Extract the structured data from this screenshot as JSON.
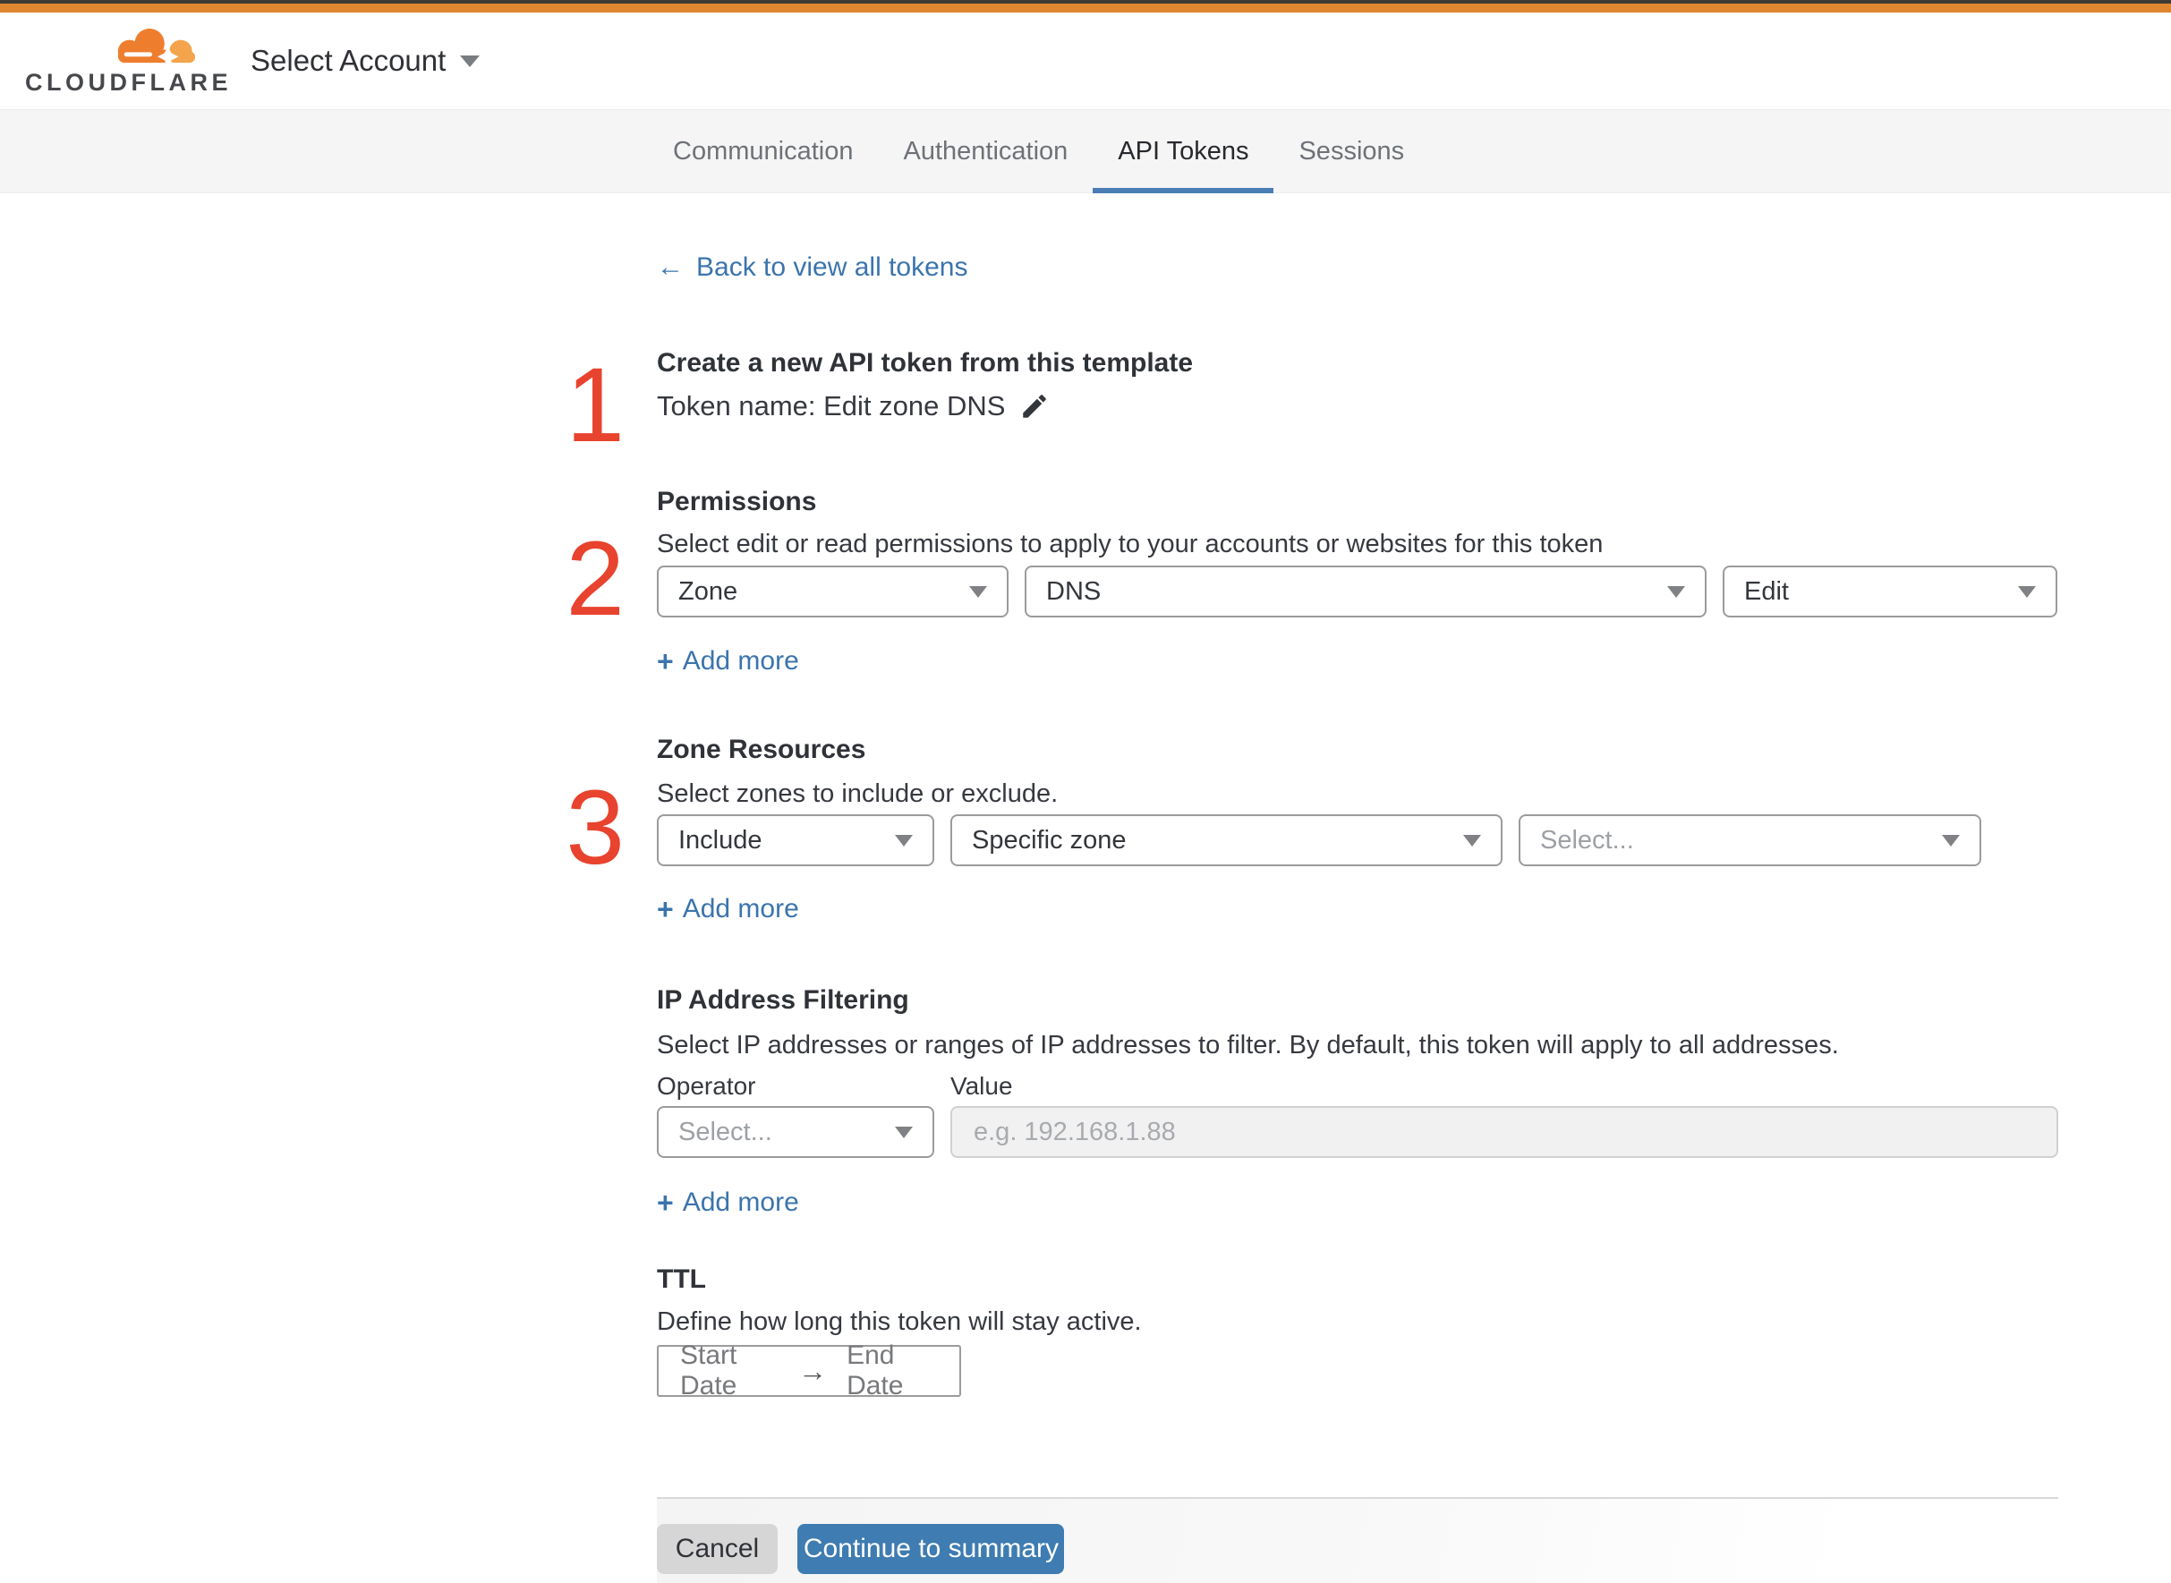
{
  "header": {
    "brand": "CLOUDFLARE",
    "account_selector_label": "Select Account"
  },
  "tabs": [
    {
      "label": "Communication"
    },
    {
      "label": "Authentication"
    },
    {
      "label": "API Tokens"
    },
    {
      "label": "Sessions"
    }
  ],
  "active_tab": "API Tokens",
  "icons": {
    "back_arrow": "←",
    "plus": "+",
    "range_arrow": "→"
  },
  "back_link_label": "Back to view all tokens",
  "steps": [
    "1",
    "2",
    "3"
  ],
  "template_section": {
    "heading": "Create a new API token from this template",
    "token_name_label": "Token name: Edit zone DNS"
  },
  "permissions": {
    "heading": "Permissions",
    "description": "Select edit or read permissions to apply to your accounts or websites for this token",
    "scope_value": "Zone",
    "resource_value": "DNS",
    "access_value": "Edit",
    "add_more_label": "Add more"
  },
  "zone_resources": {
    "heading": "Zone Resources",
    "description": "Select zones to include or exclude.",
    "mode_value": "Include",
    "type_value": "Specific zone",
    "zone_placeholder": "Select...",
    "add_more_label": "Add more"
  },
  "ip_filtering": {
    "heading": "IP Address Filtering",
    "description": "Select IP addresses or ranges of IP addresses to filter. By default, this token will apply to all addresses.",
    "operator_label": "Operator",
    "value_label": "Value",
    "operator_placeholder": "Select...",
    "value_placeholder": "e.g. 192.168.1.88",
    "add_more_label": "Add more"
  },
  "ttl": {
    "heading": "TTL",
    "description": "Define how long this token will stay active.",
    "start_label": "Start Date",
    "end_label": "End Date"
  },
  "footer": {
    "cancel_label": "Cancel",
    "continue_label": "Continue to summary"
  },
  "colors": {
    "top_bar_orange": "#df862f",
    "link_blue": "#3b74ac",
    "active_tab_underline": "#4a7eb5",
    "primary_button_blue": "#3e7cb1",
    "step_number_red": "#e8432e",
    "logo_orange": "#ee7e2e",
    "logo_light_orange": "#f3a44c"
  }
}
